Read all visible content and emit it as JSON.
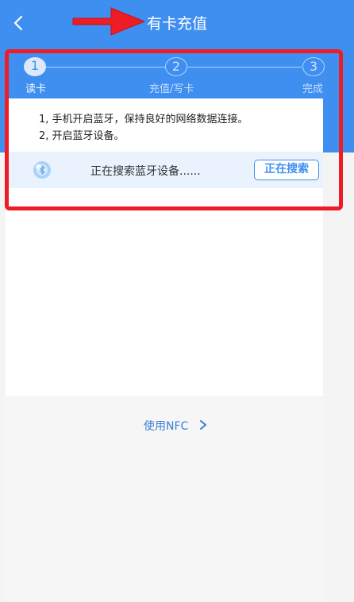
{
  "header": {
    "title": "有卡充值",
    "back_icon": "chevron-left-icon"
  },
  "steps": [
    {
      "number": "1",
      "label": "读卡",
      "active": true
    },
    {
      "number": "2",
      "label": "充值/写卡",
      "active": false
    },
    {
      "number": "3",
      "label": "完成",
      "active": false
    }
  ],
  "instructions": [
    "1, 手机开启蓝牙，保持良好的网络数据连接。",
    "2, 开启蓝牙设备。"
  ],
  "status": {
    "icon": "bluetooth-icon",
    "text": "正在搜索蓝牙设备......",
    "button_label": "正在搜索"
  },
  "nfc_link": {
    "label": "使用NFC",
    "icon": "chevron-right-icon"
  },
  "colors": {
    "primary": "#3f8ff1",
    "highlight": "#ee1c25"
  }
}
